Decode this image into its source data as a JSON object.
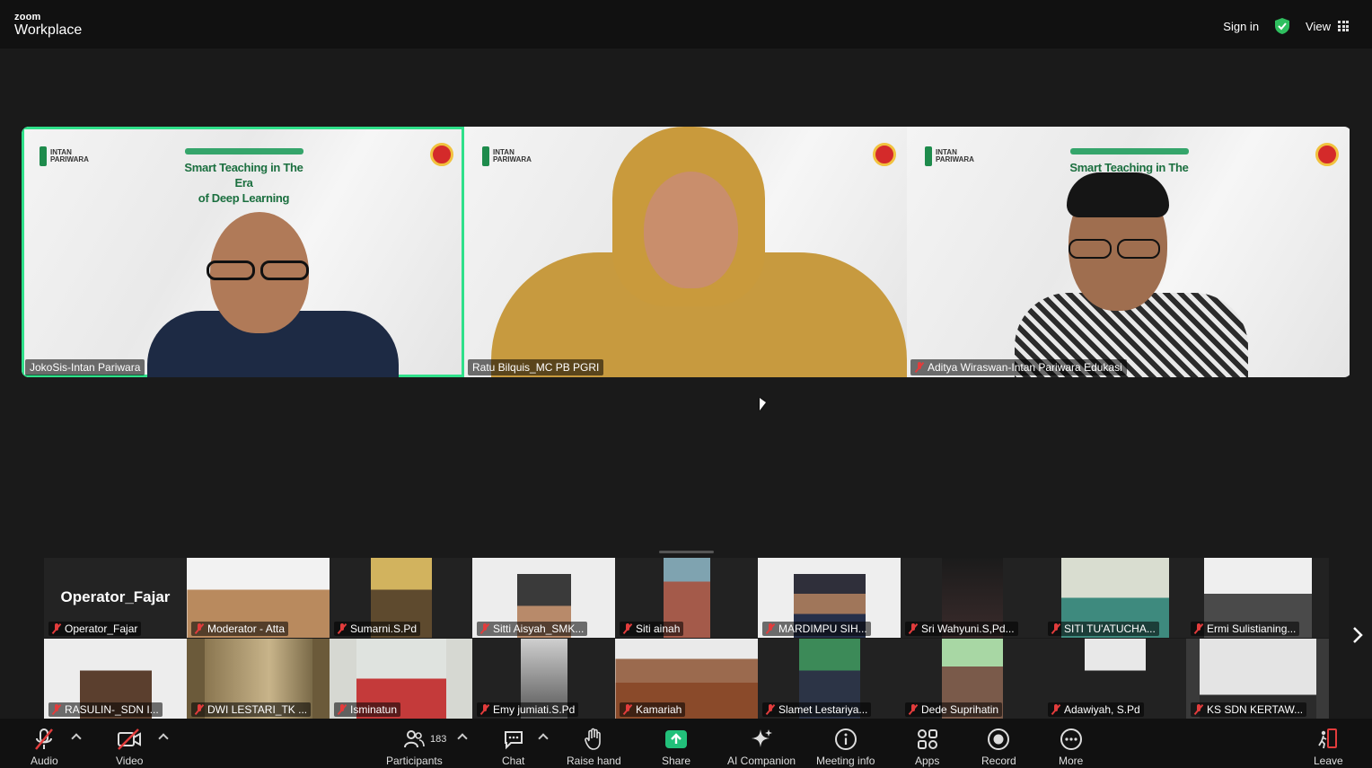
{
  "app": {
    "brand_small": "zoom",
    "brand_large": "Workplace"
  },
  "header": {
    "sign_in": "Sign in",
    "view_label": "View",
    "security_color": "#2fbf5f"
  },
  "slide": {
    "org_line1": "INTAN",
    "org_line2": "PARIWARA",
    "title_line1": "Smart Teaching in The Era",
    "title_line2": "of Deep Learning"
  },
  "speakers": [
    {
      "name": "JokoSis-Intan Pariwara",
      "active": true,
      "muted": false
    },
    {
      "name": "Ratu Bilquis_MC PB PGRI",
      "active": false,
      "muted": false
    },
    {
      "name": "Aditya Wiraswan-Intan Pariwara Edukasi",
      "active": false,
      "muted": true
    }
  ],
  "gallery": {
    "row1": [
      {
        "name": "Operator_Fajar",
        "big_name": "Operator_Fajar"
      },
      {
        "name": "Moderator - Atta"
      },
      {
        "name": "Sumarni.S.Pd"
      },
      {
        "name": "Sitti Aisyah_SMK..."
      },
      {
        "name": "Siti ainah"
      },
      {
        "name": "MARDIMPU SIH..."
      },
      {
        "name": "Sri Wahyuni.S,Pd..."
      },
      {
        "name": "SITI TU'ATUCHA..."
      },
      {
        "name": "Ermi Sulistianing..."
      }
    ],
    "row2": [
      {
        "name": "RASULIN-_SDN I..."
      },
      {
        "name": "DWI LESTARI_TK ..."
      },
      {
        "name": "Isminatun"
      },
      {
        "name": "Emy jumiati.S.Pd"
      },
      {
        "name": "Kamariah"
      },
      {
        "name": "Slamet Lestariya..."
      },
      {
        "name": "Dede Suprihatin"
      },
      {
        "name": "Adawiyah, S.Pd"
      },
      {
        "name": "KS SDN KERTAW..."
      }
    ]
  },
  "toolbar": {
    "audio": "Audio",
    "video": "Video",
    "participants": "Participants",
    "participants_count": "183",
    "chat": "Chat",
    "raise_hand": "Raise hand",
    "share": "Share",
    "ai_companion": "AI Companion",
    "meeting_info": "Meeting info",
    "apps": "Apps",
    "record": "Record",
    "more": "More",
    "leave": "Leave",
    "share_color": "#22c07a",
    "mute_color": "#e23c3c"
  }
}
